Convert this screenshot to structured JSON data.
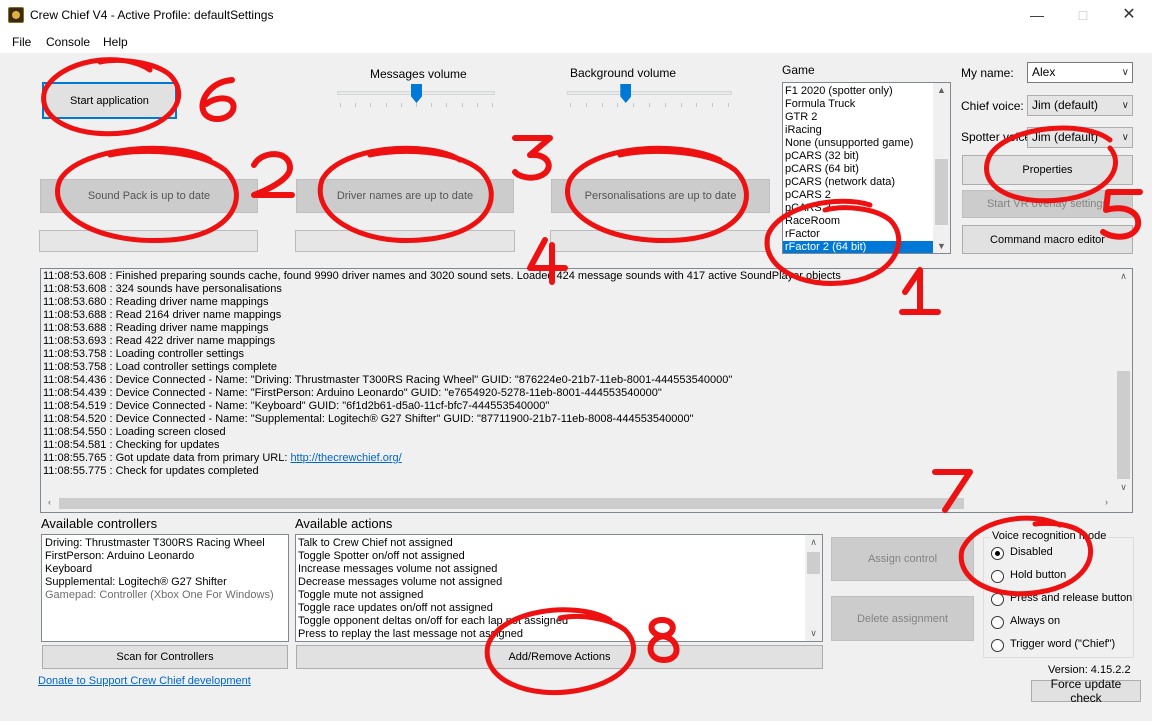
{
  "window": {
    "title": "Crew Chief V4 - Active Profile: defaultSettings",
    "icon": "crew-chief-app-icon",
    "controls": [
      "minimize-icon",
      "maximize-icon",
      "close-icon"
    ]
  },
  "menu": [
    "File",
    "Console",
    "Help"
  ],
  "start_button": "Start application",
  "volumes": {
    "messages_label": "Messages volume",
    "messages_value": 0.5,
    "background_label": "Background volume",
    "background_value": 0.35
  },
  "updates": {
    "sound_pack": "Sound Pack is up to date",
    "driver_names": "Driver names are up to date",
    "personalisations": "Personalisations are up to date"
  },
  "game": {
    "label": "Game",
    "items": [
      "F1 2020 (spotter only)",
      "Formula Truck",
      "GTR 2",
      "iRacing",
      "None (unsupported game)",
      "pCARS (32 bit)",
      "pCARS (64 bit)",
      "pCARS (network data)",
      "pCARS 2",
      "pCARS 3",
      "RaceRoom",
      "rFactor",
      "rFactor 2 (64 bit)"
    ],
    "selected": "rFactor 2 (64 bit)"
  },
  "settings": {
    "name_label": "My name:",
    "name_value": "Alex",
    "chief_voice_label": "Chief voice:",
    "chief_voice_value": "Jim (default)",
    "spotter_voice_label": "Spotter voice:",
    "spotter_voice_value": "Jim (default)",
    "properties": "Properties",
    "start_vr_overlay": "Start VR overlay settings",
    "command_macro": "Command macro editor"
  },
  "log": [
    "11:08:53.608 : Finished preparing sounds cache, found 9990 driver names and 3020 sound sets. Loaded 424 message sounds with 417 active SoundPlayer objects",
    "11:08:53.608 : 324 sounds have personalisations",
    "11:08:53.680 : Reading driver name mappings",
    "11:08:53.688 : Read 2164 driver name mappings",
    "11:08:53.688 : Reading driver name mappings",
    "11:08:53.693 : Read 422 driver name mappings",
    "11:08:53.758 : Loading controller settings",
    "11:08:53.758 : Load controller settings complete",
    "11:08:54.436 : Device Connected -  Name: \"Driving: Thrustmaster T300RS Racing Wheel\"    GUID: \"876224e0-21b7-11eb-8001-444553540000\"",
    "11:08:54.439 : Device Connected -  Name: \"FirstPerson: Arduino Leonardo\"    GUID: \"e7654920-5278-11eb-8001-444553540000\"",
    "11:08:54.519 : Device Connected -  Name: \"Keyboard\"    GUID: \"6f1d2b61-d5a0-11cf-bfc7-444553540000\"",
    "11:08:54.520 : Device Connected -  Name: \"Supplemental: Logitech® G27 Shifter\"    GUID: \"87711900-21b7-11eb-8008-444553540000\"",
    "11:08:54.550 : Loading screen closed",
    "11:08:54.581 : Checking for updates"
  ],
  "log_url_line": {
    "prefix": "11:08:55.765 : Got update data from primary URL: ",
    "link": "http://thecrewchief.org/"
  },
  "log_last": "11:08:55.775 : Check for updates completed",
  "controllers": {
    "label": "Available controllers",
    "items": [
      "Driving: Thrustmaster T300RS Racing Wheel",
      "FirstPerson: Arduino Leonardo",
      "Keyboard",
      "Supplemental: Logitech® G27 Shifter"
    ],
    "disabled_item": "Gamepad: Controller (Xbox One For Windows)",
    "scan": "Scan for Controllers"
  },
  "actions": {
    "label": "Available actions",
    "items": [
      "Talk to Crew Chief not assigned",
      "Toggle Spotter on/off not assigned",
      "Increase messages volume not assigned",
      "Decrease messages volume not assigned",
      "Toggle mute not assigned",
      "Toggle race updates on/off not assigned",
      "Toggle opponent deltas on/off for each lap not assigned",
      "Press to replay the last message not assigned"
    ],
    "add_remove": "Add/Remove Actions",
    "assign": "Assign control",
    "delete": "Delete assignment"
  },
  "voice": {
    "label": "Voice recognition mode",
    "options": [
      "Disabled",
      "Hold button",
      "Press and release button",
      "Always on",
      "Trigger word (\"Chief\")"
    ],
    "selected": "Disabled"
  },
  "footer": {
    "donate": "Donate to Support Crew Chief development",
    "version": "Version: 4.15.2.2",
    "force_update": "Force update check"
  },
  "annotations": [
    "1",
    "2",
    "3",
    "4",
    "5",
    "6",
    "7",
    "8"
  ],
  "colors": {
    "accent": "#0078d7",
    "annotation": "#ee1111",
    "link": "#0066cc"
  }
}
